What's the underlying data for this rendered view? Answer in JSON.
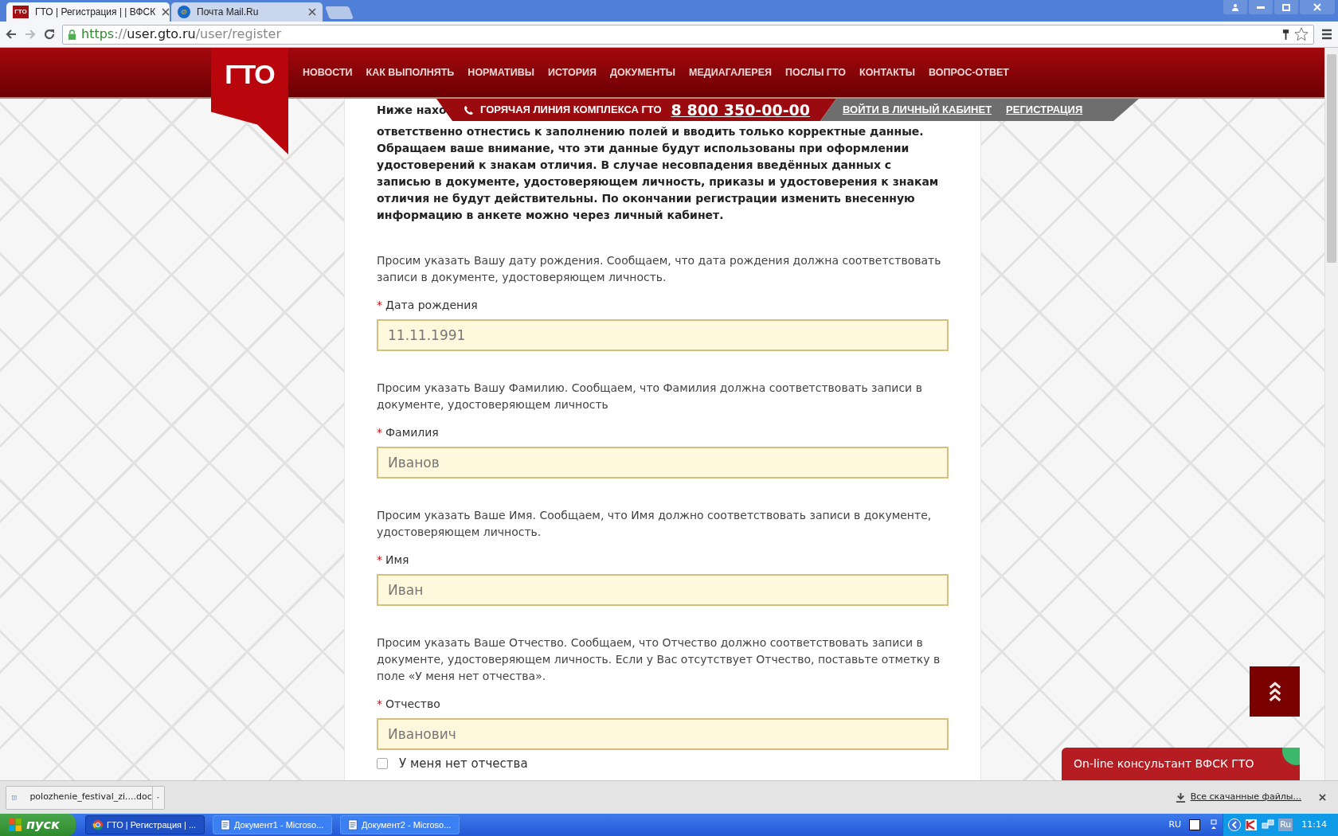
{
  "browser": {
    "tabs": [
      {
        "title": "ГТО | Регистрация | | ВФСК",
        "icon_text": "ГТО",
        "selected": true
      },
      {
        "title": "Почта Mail.Ru",
        "icon_text": "@",
        "selected": false
      }
    ],
    "url": {
      "scheme": "https",
      "separator": "://",
      "host": "user.gto.ru",
      "path": "/user/register"
    }
  },
  "site": {
    "logo": "ГТО",
    "nav": [
      "НОВОСТИ",
      "КАК ВЫПОЛНЯТЬ",
      "НОРМАТИВЫ",
      "ИСТОРИЯ",
      "ДОКУМЕНТЫ",
      "МЕДИАГАЛЕРЕЯ",
      "ПОСЛЫ ГТО",
      "КОНТАКТЫ",
      "ВОПРОС-ОТВЕТ"
    ],
    "hotline": {
      "label": "ГОРЯЧАЯ ЛИНИЯ КОМПЛЕКСА ГТО",
      "phone": "8 800 350-00-00"
    },
    "account_links": [
      "ВОЙТИ В ЛИЧНЫЙ КАБИНЕТ",
      "РЕГИСТРАЦИЯ"
    ]
  },
  "form": {
    "intro_fragment": "Ниже нахо",
    "intro": "ответственно отнестись к заполнению полей и вводить только корректные данные. Обращаем ваше внимание, что эти данные будут использованы при оформлении удостоверений к знакам отличия. В случае несовпадения введённых данных с записью в документе, удостоверяющем личность, приказы и удостоверения к знакам отличия не будут действительны. По окончании регистрации изменить внесенную информацию в анкете можно через личный кабинет.",
    "required_mark": "*",
    "fields": [
      {
        "hint": "Просим указать Вашу дату рождения. Сообщаем, что дата рождения должна соответствовать записи в документе, удостоверяющем личность.",
        "label": "Дата рождения",
        "required": true,
        "value": "11.11.1991"
      },
      {
        "hint": "Просим указать Вашу Фамилию. Сообщаем, что Фамилия должна соответствовать записи в документе, удостоверяющем личность",
        "label": "Фамилия",
        "required": true,
        "value": "Иванов"
      },
      {
        "hint": "Просим указать Ваше Имя. Сообщаем, что Имя должно соответствовать записи в документе, удостоверяющем личность.",
        "label": "Имя",
        "required": true,
        "value": "Иван"
      },
      {
        "hint": "Просим указать Ваше Отчество. Сообщаем, что Отчество должно соответствовать записи в документе, удостоверяющем личность. Если у Вас отсутствует Отчество, поставьте отметку в поле «У меня нет отчества».",
        "label": "Отчество",
        "required": true,
        "value": "Иванович"
      }
    ],
    "checkbox": {
      "label": "У меня нет отчества",
      "checked": false
    }
  },
  "consultant": "On-line консультант ВФСК ГТО",
  "downloads": {
    "file": "polozhenie_festival_zi....doc",
    "all": "Все скачанные файлы..."
  },
  "taskbar": {
    "start": "пуск",
    "items": [
      {
        "title": "ГТО | Регистрация | ...",
        "kind": "browser",
        "selected": true
      },
      {
        "title": "Документ1 - Microso...",
        "kind": "word",
        "selected": false
      },
      {
        "title": "Документ2 - Microso...",
        "kind": "word",
        "selected": false
      }
    ],
    "language": "RU",
    "tray_language": "Ru",
    "clock": "11:14"
  }
}
